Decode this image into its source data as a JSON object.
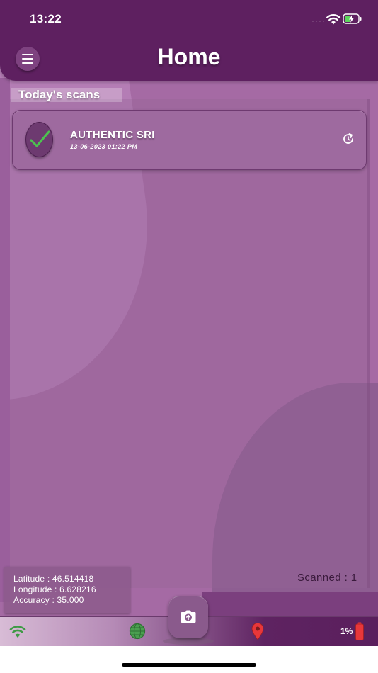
{
  "status_bar": {
    "time": "13:22",
    "signal_dots": "····",
    "wifi_icon": "wifi-icon",
    "battery_icon": "battery-charging-icon"
  },
  "header": {
    "title": "Home",
    "menu_icon": "hamburger-menu-icon"
  },
  "section": {
    "label": "Today's scans"
  },
  "scans": [
    {
      "title": "AUTHENTIC SRI",
      "date": "13-06-2023 01:22 PM",
      "status_icon": "check-icon",
      "action_icon": "refresh-icon"
    }
  ],
  "location": {
    "latitude": "Latitude : 46.514418",
    "longitude": "Longitude : 6.628216",
    "accuracy": "Accuracy : 35.000"
  },
  "scanned": {
    "text": "Scanned : 1"
  },
  "bottom_bar": {
    "battery_percent": "1%",
    "icons": [
      "wifi-signal-icon",
      "globe-icon",
      "camera-upload-icon",
      "location-pin-icon",
      "battery-low-icon"
    ]
  },
  "colors": {
    "header": "#5e2060",
    "background": "#a56aa4",
    "card": "#9e6a9f",
    "check": "#4cc24f",
    "pin": "#e8373a",
    "battery_low": "#e8373a"
  }
}
